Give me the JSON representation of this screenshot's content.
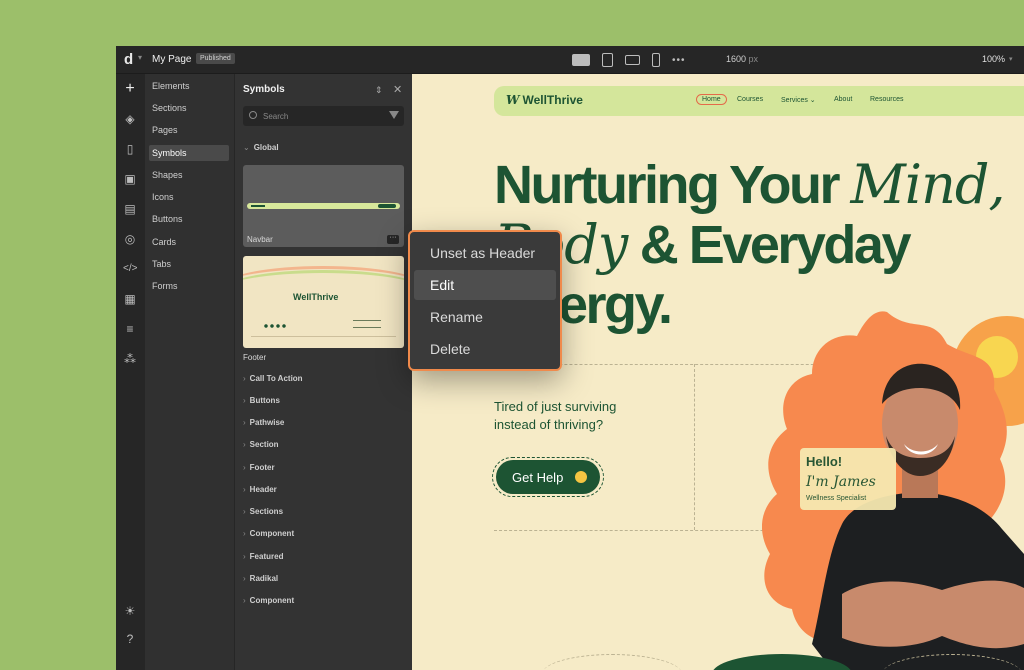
{
  "topbar": {
    "page_name": "My Page",
    "status": "Published",
    "width_value": "1600",
    "width_unit": "px",
    "zoom": "100%"
  },
  "rail_icons": [
    "plus-icon",
    "layers-icon",
    "page-icon",
    "image-icon",
    "book-icon",
    "media-icon",
    "code-icon",
    "layout-icon",
    "database-icon",
    "apps-icon",
    "sun-icon",
    "help-icon"
  ],
  "categories": [
    "Elements",
    "Sections",
    "Pages",
    "Symbols",
    "Shapes",
    "Icons",
    "Buttons",
    "Cards",
    "Tabs",
    "Forms"
  ],
  "active_category": "Symbols",
  "symbols_panel": {
    "title": "Symbols",
    "search_placeholder": "Search",
    "global_label": "Global",
    "symbols": [
      {
        "name": "Navbar"
      },
      {
        "name": "Footer",
        "logo": "WellThrive"
      }
    ],
    "groups": [
      "Call To Action",
      "Buttons",
      "Pathwise",
      "Section",
      "Footer",
      "Header",
      "Sections",
      "Component",
      "Featured",
      "Radikal",
      "Component"
    ]
  },
  "context_menu": {
    "items": [
      "Unset as Header",
      "Edit",
      "Rename",
      "Delete"
    ],
    "hovered": "Edit"
  },
  "site": {
    "brand": "WellThrive",
    "nav_links": [
      "Home",
      "Courses",
      "Services",
      "About",
      "Resources"
    ],
    "active_link": "Home",
    "hero_line1": "Nurturing Your",
    "hero_line1_italic": "Mind,",
    "hero_line2_italic": "Body",
    "hero_line2": "& Everyday",
    "hero_line3": "Energy.",
    "tagline": "Tired of just surviving instead of thriving?",
    "cta": "Get Help",
    "card_greeting": "Hello!",
    "card_name": "I'm James",
    "card_role": "Wellness Specialist"
  },
  "colors": {
    "background": "#9cbf6a",
    "brand_green": "#1d5433",
    "nav_bg": "#d4e69b",
    "canvas_bg": "#f6ebc7",
    "accent_orange": "#f08a4b",
    "flower_orange": "#f7894e"
  }
}
